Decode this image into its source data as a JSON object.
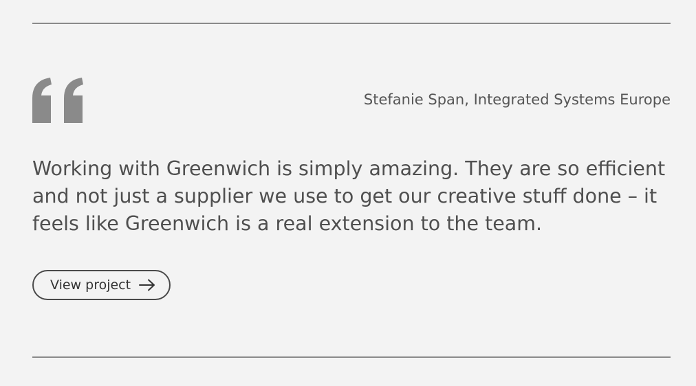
{
  "testimonial": {
    "author": "Stefanie Span, Integrated Systems Europe",
    "quote": "Working with Greenwich is simply amazing. They are so efficient and not just a supplier we use to get our creative stuff done – it feels like Greenwich is a real extension to the team.",
    "quote_icon": "quote-open-icon"
  },
  "cta": {
    "label": "View project",
    "icon": "arrow-right-icon"
  },
  "colors": {
    "background": "#f3f3f3",
    "quote_mark": "#8a8a8a",
    "text": "#4f4f4f",
    "rule": "#8a8a8a"
  }
}
